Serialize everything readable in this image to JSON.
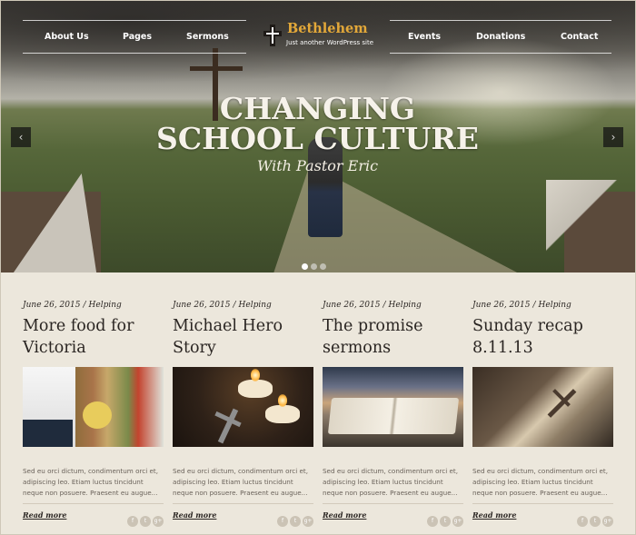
{
  "nav": {
    "left": [
      "About Us",
      "Pages",
      "Sermons"
    ],
    "right": [
      "Events",
      "Donations",
      "Contact"
    ]
  },
  "logo": {
    "title": "Bethlehem",
    "tagline": "Just another WordPress site",
    "icon": "cross-icon"
  },
  "hero": {
    "title_line1": "CHANGING",
    "title_line2": "SCHOOL CULTURE",
    "subtitle": "With Pastor Eric",
    "prev": "‹",
    "next": "›",
    "slides_total": 3,
    "active_slide": 1
  },
  "posts": [
    {
      "date": "June 26, 2015",
      "category": "Helping",
      "title_line1": "More food for",
      "title_line2": "Victoria",
      "excerpt": "Sed eu orci dictum, condimentum orci et, adipiscing leo. Etiam luctus tincidunt neque non posuere. Praesent eu augue...",
      "read_more": "Read more",
      "image": "shopping-photo"
    },
    {
      "date": "June 26, 2015",
      "category": "Helping",
      "title_line1": "Michael Hero",
      "title_line2": "Story",
      "excerpt": "Sed eu orci dictum, condimentum orci et, adipiscing leo. Etiam luctus tincidunt neque non posuere. Praesent eu augue...",
      "read_more": "Read more",
      "image": "candles-rosary-photo"
    },
    {
      "date": "June 26, 2015",
      "category": "Helping",
      "title_line1": "The promise",
      "title_line2": "sermons",
      "excerpt": "Sed eu orci dictum, condimentum orci et, adipiscing leo. Etiam luctus tincidunt neque non posuere. Praesent eu augue...",
      "read_more": "Read more",
      "image": "open-bible-photo"
    },
    {
      "date": "June 26, 2015",
      "category": "Helping",
      "title_line1": "Sunday recap",
      "title_line2": "8.11.13",
      "excerpt": "Sed eu orci dictum, condimentum orci et, adipiscing leo. Etiam luctus tincidunt neque non posuere. Praesent eu augue...",
      "read_more": "Read more",
      "image": "cross-light-photo"
    }
  ],
  "social": [
    "f",
    "t",
    "g+"
  ],
  "meta_sep": "/"
}
